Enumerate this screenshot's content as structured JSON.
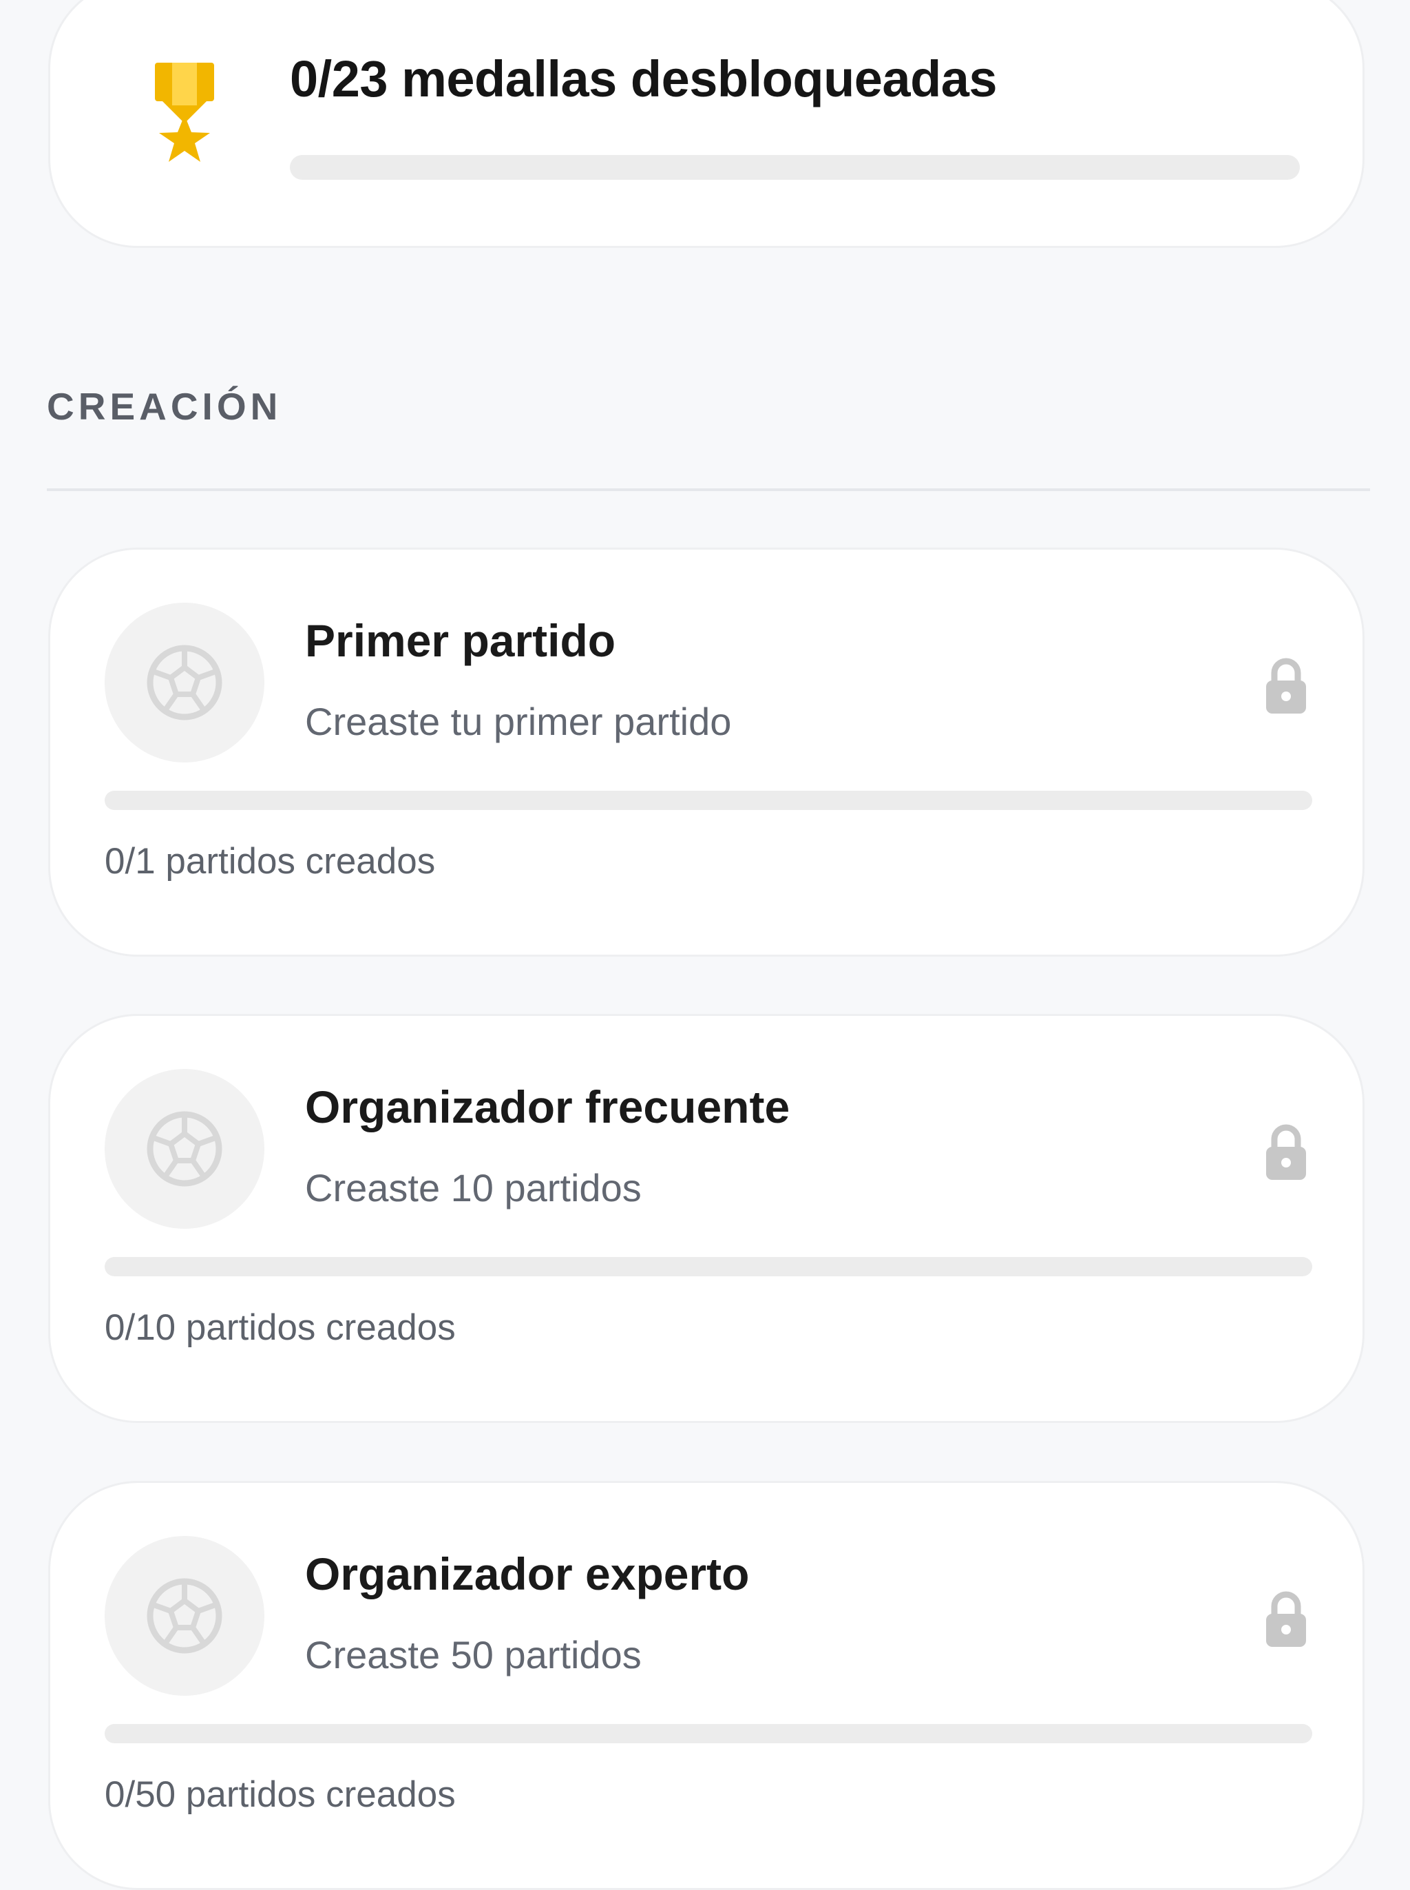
{
  "summary": {
    "title": "0/23 medallas desbloqueadas",
    "progress": 0,
    "icon": "medal-icon",
    "accent_color": "#f2b600"
  },
  "section": {
    "title": "CREACIÓN"
  },
  "medals": [
    {
      "title": "Primer partido",
      "description": "Creaste tu primer partido",
      "progress_text": "0/1 partidos creados",
      "progress": 0,
      "icon": "soccer-ball-icon",
      "status_icon": "lock-icon"
    },
    {
      "title": "Organizador frecuente",
      "description": "Creaste 10 partidos",
      "progress_text": "0/10 partidos creados",
      "progress": 0,
      "icon": "soccer-ball-icon",
      "status_icon": "lock-icon"
    },
    {
      "title": "Organizador experto",
      "description": "Creaste 50 partidos",
      "progress_text": "0/50 partidos creados",
      "progress": 0,
      "icon": "soccer-ball-icon",
      "status_icon": "lock-icon"
    }
  ],
  "colors": {
    "background": "#f7f8fa",
    "card": "#ffffff",
    "track": "#ececec",
    "locked_icon": "#c7c7c7",
    "muted_text": "#626771"
  }
}
